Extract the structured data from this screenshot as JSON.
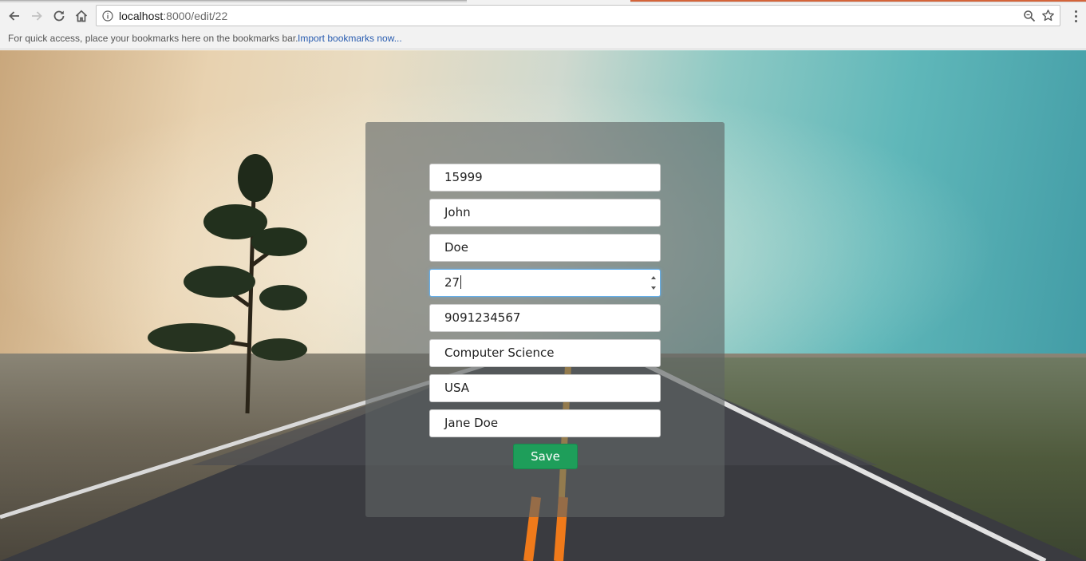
{
  "browser": {
    "url_host": "localhost",
    "url_path": ":8000/edit/22",
    "bookmarks_bar": {
      "message": "For quick access, place your bookmarks here on the bookmarks bar.",
      "import_link": "Import bookmarks now..."
    },
    "icons": {
      "back": "back-arrow-icon",
      "forward": "forward-arrow-icon",
      "reload": "reload-icon",
      "home": "home-icon",
      "info": "info-icon",
      "zoom": "zoom-icon",
      "bookmark": "star-icon",
      "menu": "kebab-menu-icon"
    }
  },
  "form": {
    "fields": [
      {
        "name": "id",
        "value": "15999"
      },
      {
        "name": "first_name",
        "value": "John"
      },
      {
        "name": "last_name",
        "value": "Doe"
      },
      {
        "name": "age",
        "value": "27",
        "type": "number",
        "focused": true
      },
      {
        "name": "phone",
        "value": "9091234567"
      },
      {
        "name": "department",
        "value": "Computer Science"
      },
      {
        "name": "country",
        "value": "USA"
      },
      {
        "name": "guardian",
        "value": "Jane Doe"
      }
    ],
    "save_label": "Save",
    "colors": {
      "save_button": "#1e9e5a",
      "focus_border": "#66afe9"
    }
  }
}
